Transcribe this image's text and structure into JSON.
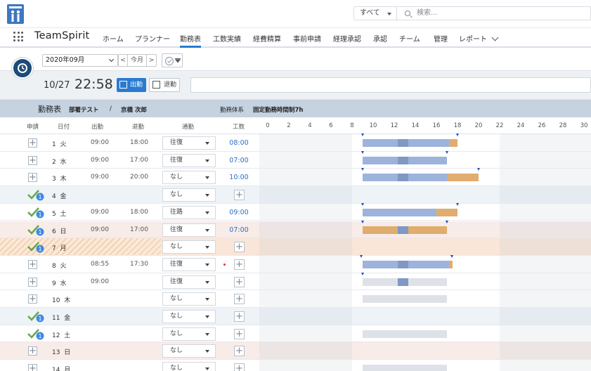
{
  "header": {
    "search_scope": "すべて",
    "search_placeholder": "検索..."
  },
  "nav": {
    "app_name": "TeamSpirit",
    "items": [
      "ホーム",
      "プランナー",
      "勤務表",
      "工数実績",
      "経費精算",
      "事前申請",
      "経理承認",
      "承認",
      "チーム",
      "管理",
      "レポート"
    ],
    "active": "勤務表"
  },
  "toolbar": {
    "month": "2020年09月",
    "prev": "<",
    "today": "今月",
    "next": ">"
  },
  "punch": {
    "date": "10/27",
    "time": "22:58",
    "clock_in": "出勤",
    "clock_out": "退勤"
  },
  "title": {
    "sheet": "勤務表",
    "dept": "部署テスト",
    "sep": "/",
    "user": "京橋 次郎",
    "system_label": "勤務体系",
    "system_value": "固定勤務時間制7h"
  },
  "columns": {
    "apply": "申請",
    "date": "日付",
    "in": "出勤",
    "out": "退勤",
    "commute": "通勤",
    "hours": "工数",
    "ticks": [
      "0",
      "2",
      "4",
      "6",
      "8",
      "10",
      "12",
      "14",
      "16",
      "18",
      "20",
      "22",
      "24",
      "26",
      "28",
      "30"
    ]
  },
  "rows": [
    {
      "day": "1",
      "wd": "火",
      "in": "09:00",
      "out": "18:00",
      "commute": "往復",
      "hours": "08:00",
      "type": "weekday",
      "approved": false,
      "bars": [
        {
          "start": 9,
          "end": 12.3,
          "c": "work"
        },
        {
          "start": 12.3,
          "end": 13.3,
          "c": "rest"
        },
        {
          "start": 13.3,
          "end": 17.2,
          "c": "work"
        },
        {
          "start": 17.2,
          "end": 18,
          "c": "ot"
        }
      ],
      "mk": [
        9,
        18
      ],
      "dot": false
    },
    {
      "day": "2",
      "wd": "水",
      "in": "09:00",
      "out": "17:00",
      "commute": "往復",
      "hours": "07:00",
      "type": "weekday",
      "approved": false,
      "bars": [
        {
          "start": 9,
          "end": 12.3,
          "c": "work"
        },
        {
          "start": 12.3,
          "end": 13.3,
          "c": "rest"
        },
        {
          "start": 13.3,
          "end": 17,
          "c": "work"
        }
      ],
      "mk": [
        9,
        17
      ],
      "dot": false
    },
    {
      "day": "3",
      "wd": "木",
      "in": "09:00",
      "out": "20:00",
      "commute": "なし",
      "hours": "10:00",
      "type": "weekday",
      "approved": false,
      "bars": [
        {
          "start": 9,
          "end": 12.3,
          "c": "work"
        },
        {
          "start": 12.3,
          "end": 13.3,
          "c": "rest"
        },
        {
          "start": 13.3,
          "end": 17,
          "c": "work"
        },
        {
          "start": 17,
          "end": 20,
          "c": "ot"
        }
      ],
      "mk": [
        9,
        20
      ],
      "dot": false
    },
    {
      "day": "4",
      "wd": "金",
      "in": "",
      "out": "",
      "commute": "なし",
      "hours": "",
      "type": "sat",
      "approved": true,
      "bars": [],
      "mk": [],
      "dot": false
    },
    {
      "day": "5",
      "wd": "土",
      "in": "09:00",
      "out": "18:00",
      "commute": "往路",
      "hours": "09:00",
      "type": "weekday",
      "approved": true,
      "bars": [
        {
          "start": 9,
          "end": 16,
          "c": "work"
        },
        {
          "start": 16,
          "end": 18,
          "c": "ot"
        }
      ],
      "mk": [
        9,
        18
      ],
      "dot": false
    },
    {
      "day": "6",
      "wd": "日",
      "in": "09:00",
      "out": "17:00",
      "commute": "往復",
      "hours": "07:00",
      "type": "sun",
      "approved": true,
      "bars": [
        {
          "start": 9,
          "end": 12.3,
          "c": "ot"
        },
        {
          "start": 12.3,
          "end": 13.3,
          "c": "rest"
        },
        {
          "start": 13.3,
          "end": 17,
          "c": "ot"
        }
      ],
      "mk": [
        9,
        17
      ],
      "dot": false
    },
    {
      "day": "7",
      "wd": "月",
      "in": "",
      "out": "",
      "commute": "なし",
      "hours": "",
      "type": "hol",
      "approved": true,
      "bars": [],
      "mk": [],
      "dot": false
    },
    {
      "day": "8",
      "wd": "火",
      "in": "08:55",
      "out": "17:30",
      "commute": "往復",
      "hours": "",
      "type": "weekday",
      "approved": false,
      "bars": [
        {
          "start": 9,
          "end": 12.3,
          "c": "work"
        },
        {
          "start": 12.3,
          "end": 13.3,
          "c": "rest"
        },
        {
          "start": 13.3,
          "end": 17.2,
          "c": "work"
        },
        {
          "start": 17.2,
          "end": 17.5,
          "c": "ot"
        }
      ],
      "mk": [
        8.9,
        17.5
      ],
      "dot": true
    },
    {
      "day": "9",
      "wd": "水",
      "in": "09:00",
      "out": "",
      "commute": "往復",
      "hours": "",
      "type": "weekday",
      "approved": false,
      "bars": [
        {
          "start": 9,
          "end": 12.3,
          "c": "empty"
        },
        {
          "start": 12.3,
          "end": 13.3,
          "c": "rest"
        },
        {
          "start": 13.3,
          "end": 17,
          "c": "empty"
        }
      ],
      "mk": [
        9
      ],
      "dot": false
    },
    {
      "day": "10",
      "wd": "木",
      "in": "",
      "out": "",
      "commute": "なし",
      "hours": "",
      "type": "weekday",
      "approved": false,
      "bars": [
        {
          "start": 9,
          "end": 17,
          "c": "empty"
        }
      ],
      "mk": [],
      "dot": false
    },
    {
      "day": "11",
      "wd": "金",
      "in": "",
      "out": "",
      "commute": "なし",
      "hours": "",
      "type": "sat",
      "approved": true,
      "bars": [],
      "mk": [],
      "dot": false
    },
    {
      "day": "12",
      "wd": "土",
      "in": "",
      "out": "",
      "commute": "なし",
      "hours": "",
      "type": "weekday",
      "approved": true,
      "bars": [
        {
          "start": 9,
          "end": 17,
          "c": "empty"
        }
      ],
      "mk": [],
      "dot": false
    },
    {
      "day": "13",
      "wd": "日",
      "in": "",
      "out": "",
      "commute": "なし",
      "hours": "",
      "type": "sun",
      "approved": false,
      "bars": [],
      "mk": [],
      "dot": false
    },
    {
      "day": "14",
      "wd": "月",
      "in": "",
      "out": "",
      "commute": "なし",
      "hours": "",
      "type": "weekday",
      "approved": false,
      "bars": [
        {
          "start": 9,
          "end": 17,
          "c": "empty"
        }
      ],
      "mk": [],
      "dot": false
    }
  ],
  "colors": {
    "work": "#9db3dc",
    "rest": "#7f98c4",
    "ot": "#e0ad6e",
    "empty": "#dfe1e8",
    "accent": "#2a7bd0",
    "marker": "#1e4fc2",
    "check": "#6aa84f",
    "badge": "#3d8be0"
  }
}
